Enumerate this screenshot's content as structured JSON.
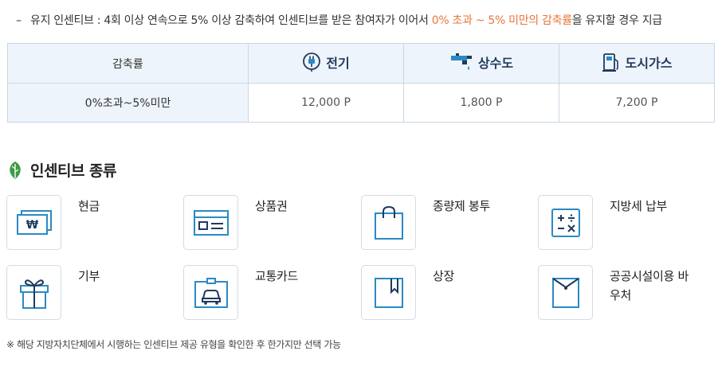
{
  "notice": {
    "dash": "–",
    "text_before": "유지 인센티브 : 4회 이상 연속으로 5% 이상 감축하여 인센티브를 받은 참여자가 이어서 ",
    "highlight": "0% 초과 ~ 5% 미만의 감축률",
    "text_after": "을 유지할 경우 지급"
  },
  "table": {
    "header": {
      "rate": "감축률",
      "electricity": "전기",
      "water": "상수도",
      "gas": "도시가스"
    },
    "rows": [
      {
        "rate": "0%초과~5%미만",
        "electricity": "12,000 P",
        "water": "1,800 P",
        "gas": "7,200 P"
      }
    ]
  },
  "section": {
    "title": "인센티브 종류",
    "icon": "leaf-icon"
  },
  "incentives": [
    {
      "label": "현금",
      "icon": "cash-icon"
    },
    {
      "label": "상품권",
      "icon": "gift-certificate-icon"
    },
    {
      "label": "종량제 봉투",
      "icon": "bag-icon"
    },
    {
      "label": "지방세 납부",
      "icon": "calculator-icon"
    },
    {
      "label": "기부",
      "icon": "gift-box-icon"
    },
    {
      "label": "교통카드",
      "icon": "transit-card-icon"
    },
    {
      "label": "상장",
      "icon": "award-book-icon"
    },
    {
      "label": "공공시설이용 바우처",
      "icon": "voucher-envelope-icon"
    }
  ],
  "footnote": "※ 해당 지방자치단체에서 시행하는 인센티브 제공 유형을 확인한 후 한가지만 선택 가능",
  "colors": {
    "accent_blue": "#2a8ac4",
    "highlight_orange": "#e8763a",
    "header_bg": "#eef4fb",
    "border": "#c9d6e3",
    "leaf_green": "#3a9a45"
  }
}
